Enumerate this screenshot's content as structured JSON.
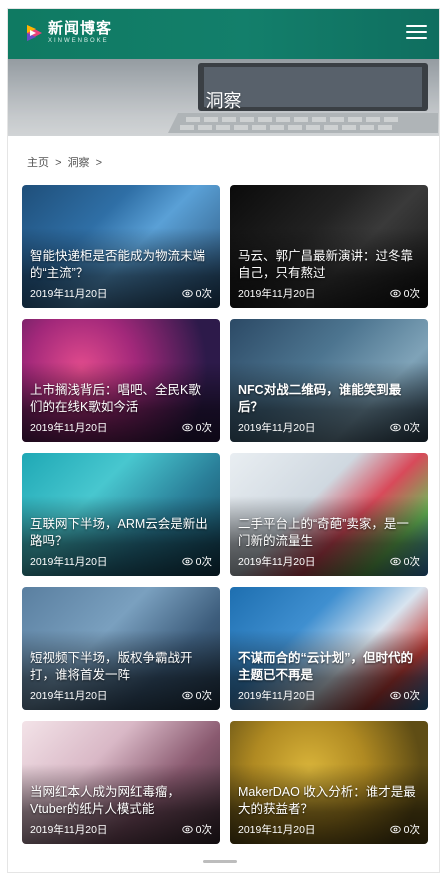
{
  "header": {
    "logo_cn": "新闻博客",
    "logo_en": "XINWENBOKE",
    "menu_icon": "hamburger-menu-icon"
  },
  "banner": {
    "title": "洞察"
  },
  "breadcrumb": {
    "home": "主页",
    "sep": ">",
    "current": "洞察",
    "tail": ">"
  },
  "cards": [
    {
      "title": "智能快递柜是否能成为物流末端的“主流”？",
      "date": "2019年11月20日",
      "views": "0次",
      "bold": false
    },
    {
      "title": "马云、郭广昌最新演讲：过冬靠自己，只有熬过",
      "date": "2019年11月20日",
      "views": "0次",
      "bold": false
    },
    {
      "title": "上市搁浅背后：唱吧、全民K歌们的在线K歌如今活",
      "date": "2019年11月20日",
      "views": "0次",
      "bold": false
    },
    {
      "title": "NFC对战二维码，谁能笑到最后？",
      "date": "2019年11月20日",
      "views": "0次",
      "bold": true
    },
    {
      "title": "互联网下半场，ARM云会是新出路吗？",
      "date": "2019年11月20日",
      "views": "0次",
      "bold": false
    },
    {
      "title": "二手平台上的“奇葩”卖家，是一门新的流量生",
      "date": "2019年11月20日",
      "views": "0次",
      "bold": false
    },
    {
      "title": "短视频下半场，版权争霸战开打，谁将首发一阵",
      "date": "2019年11月20日",
      "views": "0次",
      "bold": false
    },
    {
      "title": "不谋而合的“云计划”，但时代的主题已不再是",
      "date": "2019年11月20日",
      "views": "0次",
      "bold": true
    },
    {
      "title": "当网红本人成为网红毒瘤，Vtuber的纸片人模式能",
      "date": "2019年11月20日",
      "views": "0次",
      "bold": false
    },
    {
      "title": "MakerDAO 收入分析：谁才是最大的获益者？",
      "date": "2019年11月20日",
      "views": "0次",
      "bold": false
    }
  ],
  "colors": {
    "header_bg": "#137f6b",
    "card_text": "#ffffff"
  }
}
